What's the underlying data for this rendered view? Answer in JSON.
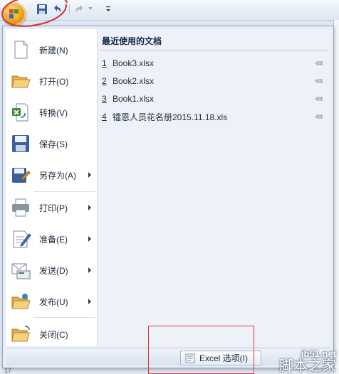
{
  "toolbar": {
    "icons": [
      "office-button",
      "save-icon",
      "undo-icon",
      "redo-icon",
      "customize-qat-icon"
    ]
  },
  "menu": {
    "items": [
      {
        "label": "新建(N)",
        "icon": "new-document-icon",
        "submenu": false
      },
      {
        "label": "打开(O)",
        "icon": "open-folder-icon",
        "submenu": false
      },
      {
        "label": "转换(V)",
        "icon": "convert-icon",
        "submenu": false
      },
      {
        "label": "保存(S)",
        "icon": "save-icon",
        "submenu": false
      },
      {
        "label": "另存为(A)",
        "icon": "save-as-icon",
        "submenu": true
      },
      {
        "label": "打印(P)",
        "icon": "printer-icon",
        "submenu": true
      },
      {
        "label": "准备(E)",
        "icon": "prepare-icon",
        "submenu": true
      },
      {
        "label": "发送(D)",
        "icon": "send-icon",
        "submenu": true
      },
      {
        "label": "发布(U)",
        "icon": "publish-icon",
        "submenu": true
      },
      {
        "label": "关闭(C)",
        "icon": "close-folder-icon",
        "submenu": false
      }
    ]
  },
  "recent": {
    "title": "最近使用的文档",
    "docs": [
      {
        "num": "1",
        "name": "Book3.xlsx"
      },
      {
        "num": "2",
        "name": "Book2.xlsx"
      },
      {
        "num": "3",
        "name": "Book1.xlsx"
      },
      {
        "num": "4",
        "name": "镭恩人员花名册2015.11.18.xls"
      }
    ]
  },
  "footer": {
    "excel_options_label": "Excel 选项(I)"
  },
  "sheet": {
    "row_label": "17"
  },
  "watermark": {
    "site": "jb51.net",
    "name": "脚本之家"
  },
  "colors": {
    "accent_orange": "#f3a81f",
    "highlight_red": "#d43b3b",
    "menu_bg": "#e9eef6"
  }
}
